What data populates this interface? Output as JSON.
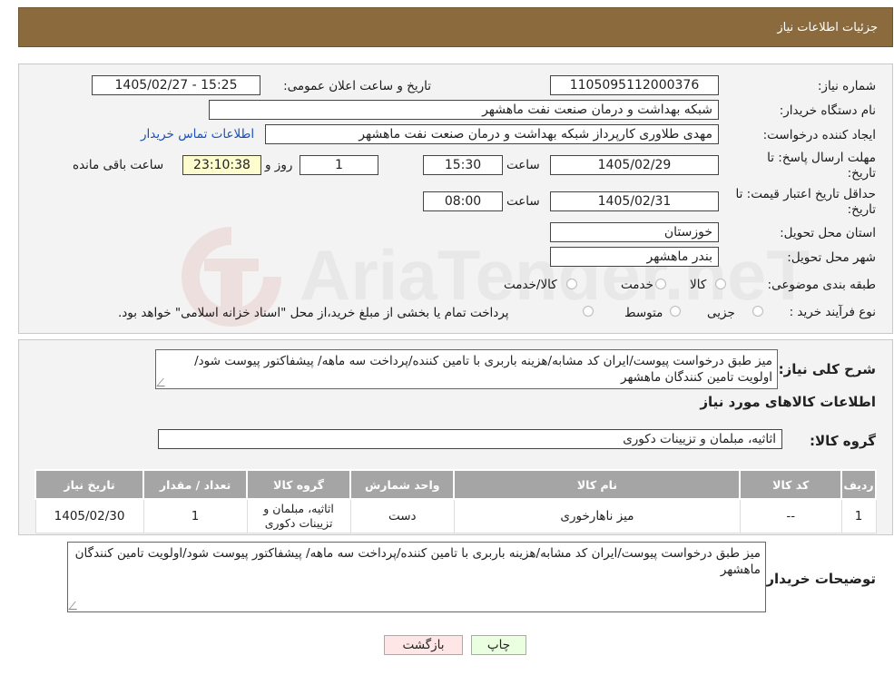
{
  "header": {
    "title": "جزئیات اطلاعات نیاز"
  },
  "watermark": {
    "text": "AriaTender.neT"
  },
  "form": {
    "need_number": {
      "label": "شماره نیاز:",
      "value": "1105095112000376"
    },
    "announce": {
      "label": "تاریخ و ساعت اعلان عمومی:",
      "value": "1405/02/27 - 15:25"
    },
    "buyer": {
      "label": "نام دستگاه خریدار:",
      "value": "شبکه بهداشت و درمان صنعت نفت ماهشهر"
    },
    "requester": {
      "label": "ایجاد کننده درخواست:",
      "value": "مهدی طلاوری کارپرداز شبکه بهداشت و درمان صنعت نفت ماهشهر",
      "contact_link": "اطلاعات تماس خریدار"
    },
    "deadline": {
      "label_line1": "مهلت ارسال پاسخ: تا",
      "label_line2": "تاریخ:",
      "date": "1405/02/29",
      "time_label": "ساعت",
      "time": "15:30",
      "days": "1",
      "days_label": "روز و",
      "remaining": "23:10:38",
      "remaining_label": "ساعت باقی مانده"
    },
    "validity": {
      "label_line1": "حداقل تاریخ اعتبار قیمت: تا",
      "label_line2": "تاریخ:",
      "date": "1405/02/31",
      "time_label": "ساعت",
      "time": "08:00"
    },
    "province": {
      "label": "استان محل تحویل:",
      "value": "خوزستان"
    },
    "city": {
      "label": "شهر محل تحویل:",
      "value": "بندر ماهشهر"
    },
    "category": {
      "label": "طبقه بندی موضوعی:",
      "options": [
        "کالا",
        "خدمت",
        "کالا/خدمت"
      ]
    },
    "process": {
      "label": "نوع فرآیند خرید :",
      "options": [
        "جزیی",
        "متوسط"
      ],
      "note": "پرداخت تمام یا بخشی از مبلغ خرید،از محل \"اسناد خزانه اسلامی\" خواهد بود."
    }
  },
  "summary": {
    "label": "شرح کلی نیاز:",
    "text": "میز طبق درخواست پیوست/ایران کد مشابه/هزینه باربری با تامین کننده/پرداخت سه ماهه/ پیشفاکتور پیوست شود/اولویت تامین کنندگان ماهشهر"
  },
  "goods_info": {
    "title": "اطلاعات کالاهای مورد نیاز",
    "group_label": "گروه کالا:",
    "group_value": "اثاثیه، مبلمان و تزیینات دکوری"
  },
  "table": {
    "headers": [
      "ردیف",
      "کد کالا",
      "نام کالا",
      "واحد شمارش",
      "گروه کالا",
      "تعداد / مقدار",
      "تاریخ نیاز"
    ],
    "rows": [
      [
        "1",
        "--",
        "میز ناهارخوری",
        "دست",
        "اثاثیه، مبلمان و تزیینات دکوری",
        "1",
        "1405/02/30"
      ]
    ]
  },
  "buyer_notes": {
    "label": "توضیحات خریدار:",
    "text": "میز طبق درخواست پیوست/ایران کد مشابه/هزینه باربری با تامین کننده/پرداخت سه ماهه/ پیشفاکتور پیوست شود/اولویت تامین کنندگان ماهشهر"
  },
  "buttons": {
    "print": "چاپ",
    "back": "بازگشت"
  },
  "colors": {
    "header_bg": "#8b6a3e",
    "table_header_bg": "#a5a5a5",
    "remaining_bg": "#fdfccf",
    "print_bg": "#eaffe0",
    "back_bg": "#ffe6e6"
  }
}
